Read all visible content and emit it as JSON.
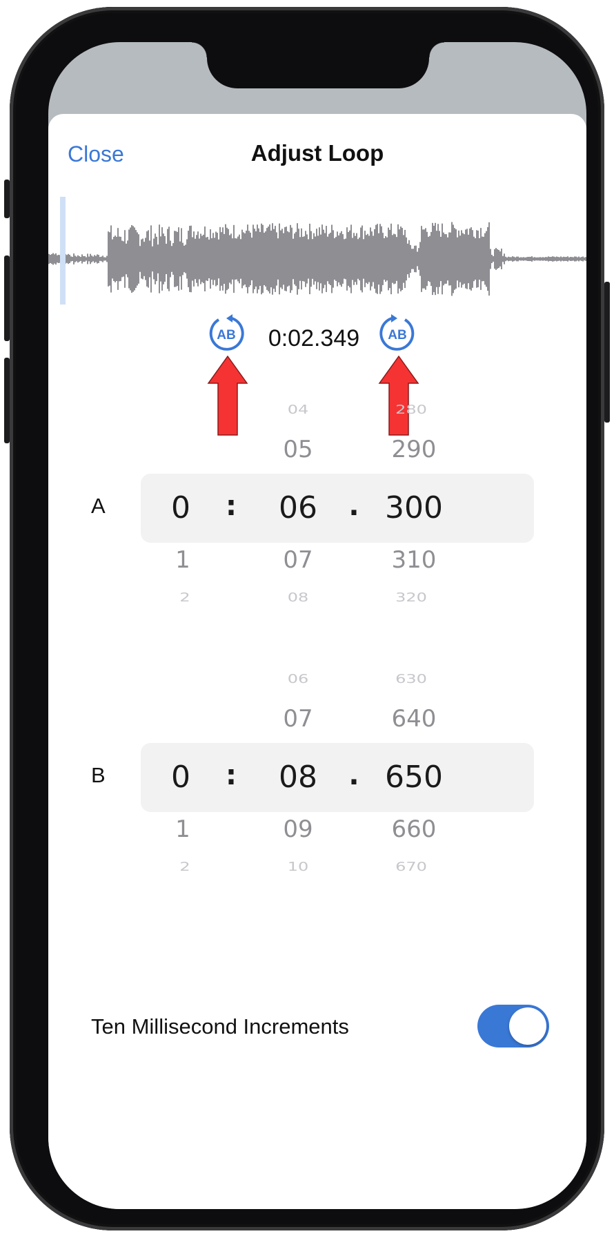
{
  "nav": {
    "close_label": "Close",
    "title": "Adjust Loop"
  },
  "loop_controls": {
    "set_a_icon": "ab-loop-back-icon",
    "set_b_icon": "ab-loop-forward-icon",
    "current_time": "0:02.349",
    "playhead_position": 0.03
  },
  "picker_a": {
    "label": "A",
    "minutes": {
      "prev2": "",
      "prev1": "",
      "selected": "0",
      "next1": "1",
      "next2": "2"
    },
    "seconds": {
      "prev2": "04",
      "prev1": "05",
      "selected": "06",
      "next1": "07",
      "next2": "08"
    },
    "millis": {
      "prev2": "280",
      "prev1": "290",
      "selected": "300",
      "next1": "310",
      "next2": "320"
    },
    "colon": ":",
    "dot": "."
  },
  "picker_b": {
    "label": "B",
    "minutes": {
      "prev2": "",
      "prev1": "",
      "selected": "0",
      "next1": "1",
      "next2": "2"
    },
    "seconds": {
      "prev2": "06",
      "prev1": "07",
      "selected": "08",
      "next1": "09",
      "next2": "10"
    },
    "millis": {
      "prev2": "630",
      "prev1": "640",
      "selected": "650",
      "next1": "660",
      "next2": "670"
    },
    "colon": ":",
    "dot": "."
  },
  "settings": {
    "ten_ms_label": "Ten Millisecond Increments",
    "ten_ms_enabled": true
  },
  "colors": {
    "accent": "#3a78d6",
    "waveform": "#8e8e93",
    "hint_arrow": "#f53333",
    "playhead": "#cfe0f6"
  }
}
